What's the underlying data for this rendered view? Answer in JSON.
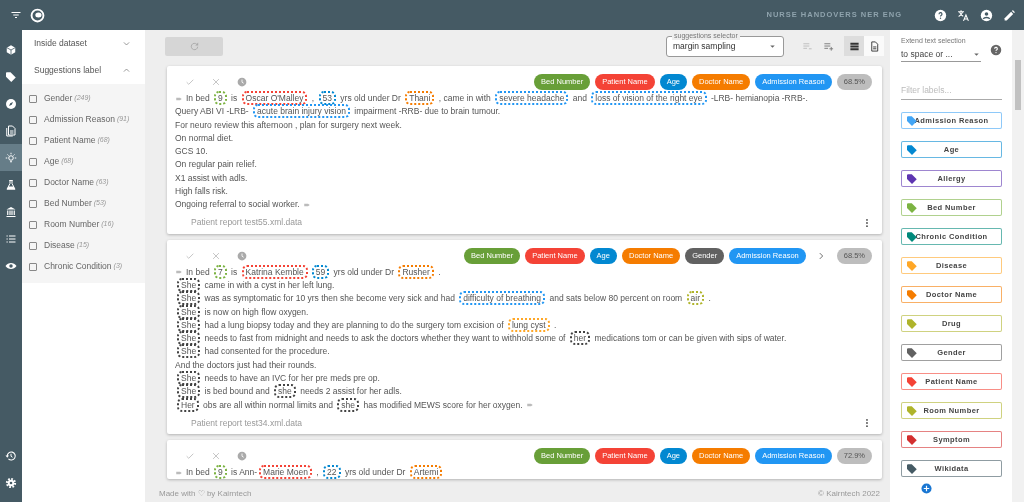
{
  "top_bar": {
    "title": "NURSE HANDOVERS NER ENG"
  },
  "nav_items": [
    {
      "selected": false
    },
    {
      "selected": false
    },
    {
      "selected": false
    },
    {
      "selected": false
    },
    {
      "selected": true
    },
    {
      "selected": false
    },
    {
      "selected": false
    },
    {
      "selected": false
    },
    {
      "selected": false
    }
  ],
  "filter_panel": {
    "sections": [
      {
        "title": "Inside dataset",
        "expanded": false
      },
      {
        "title": "Suggestions label",
        "expanded": true
      }
    ],
    "options": [
      {
        "label": "Gender",
        "count": "(249)",
        "checked": false
      },
      {
        "label": "Admission Reason",
        "count": "(91)",
        "checked": false
      },
      {
        "label": "Patient Name",
        "count": "(68)",
        "checked": false
      },
      {
        "label": "Age",
        "count": "(68)",
        "checked": false
      },
      {
        "label": "Doctor Name",
        "count": "(63)",
        "checked": false
      },
      {
        "label": "Bed Number",
        "count": "(53)",
        "checked": false
      },
      {
        "label": "Room Number",
        "count": "(16)",
        "checked": false
      },
      {
        "label": "Disease",
        "count": "(15)",
        "checked": false
      },
      {
        "label": "Chronic Condition",
        "count": "(3)",
        "checked": false
      }
    ]
  },
  "toolbar": {
    "selector": {
      "label": "suggestions selector",
      "value": "margin sampling"
    },
    "views": [
      {
        "selected": true
      },
      {
        "selected": false
      }
    ]
  },
  "documents": [
    {
      "labels": [
        {
          "label": "Bed Number",
          "color": "#689f38"
        },
        {
          "label": "Patient Name",
          "color": "#f44336"
        },
        {
          "label": "Age",
          "color": "#0288d1"
        },
        {
          "label": "Doctor Name",
          "color": "#f57c00"
        },
        {
          "label": "Admission Reason",
          "color": "#2196f3"
        }
      ],
      "more": false,
      "score": "68.5%",
      "lines": [
        [
          {
            "text": "In bed "
          },
          {
            "text": "9",
            "color": "#7cb342"
          },
          {
            "text": " is "
          },
          {
            "text": "Oscar O'Malley",
            "color": "#f44336"
          },
          {
            "text": " , "
          },
          {
            "text": "53",
            "color": "#0288d1"
          },
          {
            "text": " yrs old under Dr "
          },
          {
            "text": "Thani",
            "color": "#f57c00"
          },
          {
            "text": " , came in with "
          },
          {
            "text": "severe headache",
            "color": "#2196f3"
          },
          {
            "text": " and "
          },
          {
            "text": "loss of vision of the right eye",
            "color": "#2196f3"
          },
          {
            "text": " -LRB- hemianopia -RRB-."
          }
        ],
        [
          {
            "text": "Query ABI VI -LRB- "
          },
          {
            "text": "acute brain injury vision",
            "color": "#2196f3"
          },
          {
            "text": " impairment -RRB- due to brain tumour."
          }
        ],
        [
          {
            "text": "For neuro review this afternoon , plan for surgery next week."
          }
        ],
        [
          {
            "text": "On normal diet."
          }
        ],
        [
          {
            "text": "GCS 10."
          }
        ],
        [
          {
            "text": "On regular pain relief."
          }
        ],
        [
          {
            "text": "X1 assist with adls."
          }
        ],
        [
          {
            "text": "High falls risk."
          }
        ],
        [
          {
            "text": "Ongoing referral to social worker."
          }
        ]
      ],
      "source": "Patient report test55.xml.data"
    },
    {
      "labels": [
        {
          "label": "Bed Number",
          "color": "#689f38"
        },
        {
          "label": "Patient Name",
          "color": "#f44336"
        },
        {
          "label": "Age",
          "color": "#0288d1"
        },
        {
          "label": "Doctor Name",
          "color": "#f57c00"
        },
        {
          "label": "Gender",
          "color": "#616161"
        },
        {
          "label": "Admission Reason",
          "color": "#2196f3"
        }
      ],
      "more": true,
      "score": "68.5%",
      "lines": [
        [
          {
            "text": "In bed "
          },
          {
            "text": "7",
            "color": "#7cb342"
          },
          {
            "text": " is "
          },
          {
            "text": "Katrina Kemble",
            "color": "#f44336"
          },
          {
            "text": "59",
            "color": "#0288d1"
          },
          {
            "text": " yrs old under Dr "
          },
          {
            "text": "Rusher",
            "color": "#f57c00"
          },
          {
            "text": " ."
          }
        ],
        [
          {
            "text": "She",
            "color": "#424242"
          },
          {
            "text": " came in with a cyst in her left lung."
          }
        ],
        [
          {
            "text": "She",
            "color": "#424242"
          },
          {
            "text": " was as symptomatic for 10 yrs then she become very sick and had "
          },
          {
            "text": "difficulty of breathing",
            "color": "#2196f3"
          },
          {
            "text": " and sats below 80 percent on room "
          },
          {
            "text": "air",
            "color": "#afb42b"
          },
          {
            "text": " ."
          }
        ],
        [
          {
            "text": "She",
            "color": "#424242"
          },
          {
            "text": " is now on high flow oxygen."
          }
        ],
        [
          {
            "text": "She",
            "color": "#424242"
          },
          {
            "text": " had a lung biopsy today and they are planning to do the surgery tom excision of "
          },
          {
            "text": "lung cyst",
            "color": "#ffa726"
          },
          {
            "text": " ."
          }
        ],
        [
          {
            "text": "She",
            "color": "#424242"
          },
          {
            "text": " needs to fast from midnight and needs to ask the doctors whether they want to withhold some of "
          },
          {
            "text": "her",
            "color": "#424242"
          },
          {
            "text": " medications tom or can be given with sips of water."
          }
        ],
        [
          {
            "text": "She",
            "color": "#424242"
          },
          {
            "text": " had consented for the procedure."
          }
        ],
        [
          {
            "text": "And the doctors just had their rounds."
          }
        ],
        [
          {
            "text": "She",
            "color": "#424242"
          },
          {
            "text": " needs to have an IVC for her pre meds pre op."
          }
        ],
        [
          {
            "text": "She",
            "color": "#424242"
          },
          {
            "text": " is bed bound and "
          },
          {
            "text": "she",
            "color": "#424242"
          },
          {
            "text": " needs 2 assist for her adls."
          }
        ],
        [
          {
            "text": "Her",
            "color": "#424242"
          },
          {
            "text": " obs are all within normal limits and "
          },
          {
            "text": "she",
            "color": "#424242"
          },
          {
            "text": " has modified MEWS score for her oxygen."
          }
        ]
      ],
      "source": "Patient report test34.xml.data"
    },
    {
      "labels": [
        {
          "label": "Bed Number",
          "color": "#689f38"
        },
        {
          "label": "Patient Name",
          "color": "#f44336"
        },
        {
          "label": "Age",
          "color": "#0288d1"
        },
        {
          "label": "Doctor Name",
          "color": "#f57c00"
        },
        {
          "label": "Admission Reason",
          "color": "#2196f3"
        }
      ],
      "more": false,
      "score": "72.9%",
      "lines": [
        [
          {
            "text": "In bed "
          },
          {
            "text": "9",
            "color": "#7cb342"
          },
          {
            "text": " is Ann-"
          },
          {
            "text": "Marie Moen",
            "color": "#f44336"
          },
          {
            "text": " , "
          },
          {
            "text": "22",
            "color": "#0288d1"
          },
          {
            "text": " yrs old under Dr "
          },
          {
            "text": "Artemi",
            "color": "#f57c00"
          }
        ]
      ]
    }
  ],
  "footer": {
    "left": "Made with ♡ by Kairntech",
    "right": "© Kairntech 2022"
  },
  "right_panel": {
    "extend_selection": {
      "label": "Extend text selection",
      "value": "to space or ..."
    },
    "filter": {
      "placeholder": "Filter labels..."
    },
    "labels": [
      {
        "label": "Admission Reason",
        "color": "#42a5f5"
      },
      {
        "label": "Age",
        "color": "#0288d1"
      },
      {
        "label": "Allergy",
        "color": "#5e35b1"
      },
      {
        "label": "Bed Number",
        "color": "#7cb342"
      },
      {
        "label": "Chronic Condition",
        "color": "#00897b"
      },
      {
        "label": "Disease",
        "color": "#ffa726"
      },
      {
        "label": "Doctor Name",
        "color": "#f57c00"
      },
      {
        "label": "Drug",
        "color": "#afb42b"
      },
      {
        "label": "Gender",
        "color": "#616161"
      },
      {
        "label": "Patient Name",
        "color": "#f44336"
      },
      {
        "label": "Room Number",
        "color": "#afb42b"
      },
      {
        "label": "Symptom",
        "color": "#d32f2f"
      },
      {
        "label": "Wikidata",
        "color": "#455a64"
      }
    ]
  }
}
